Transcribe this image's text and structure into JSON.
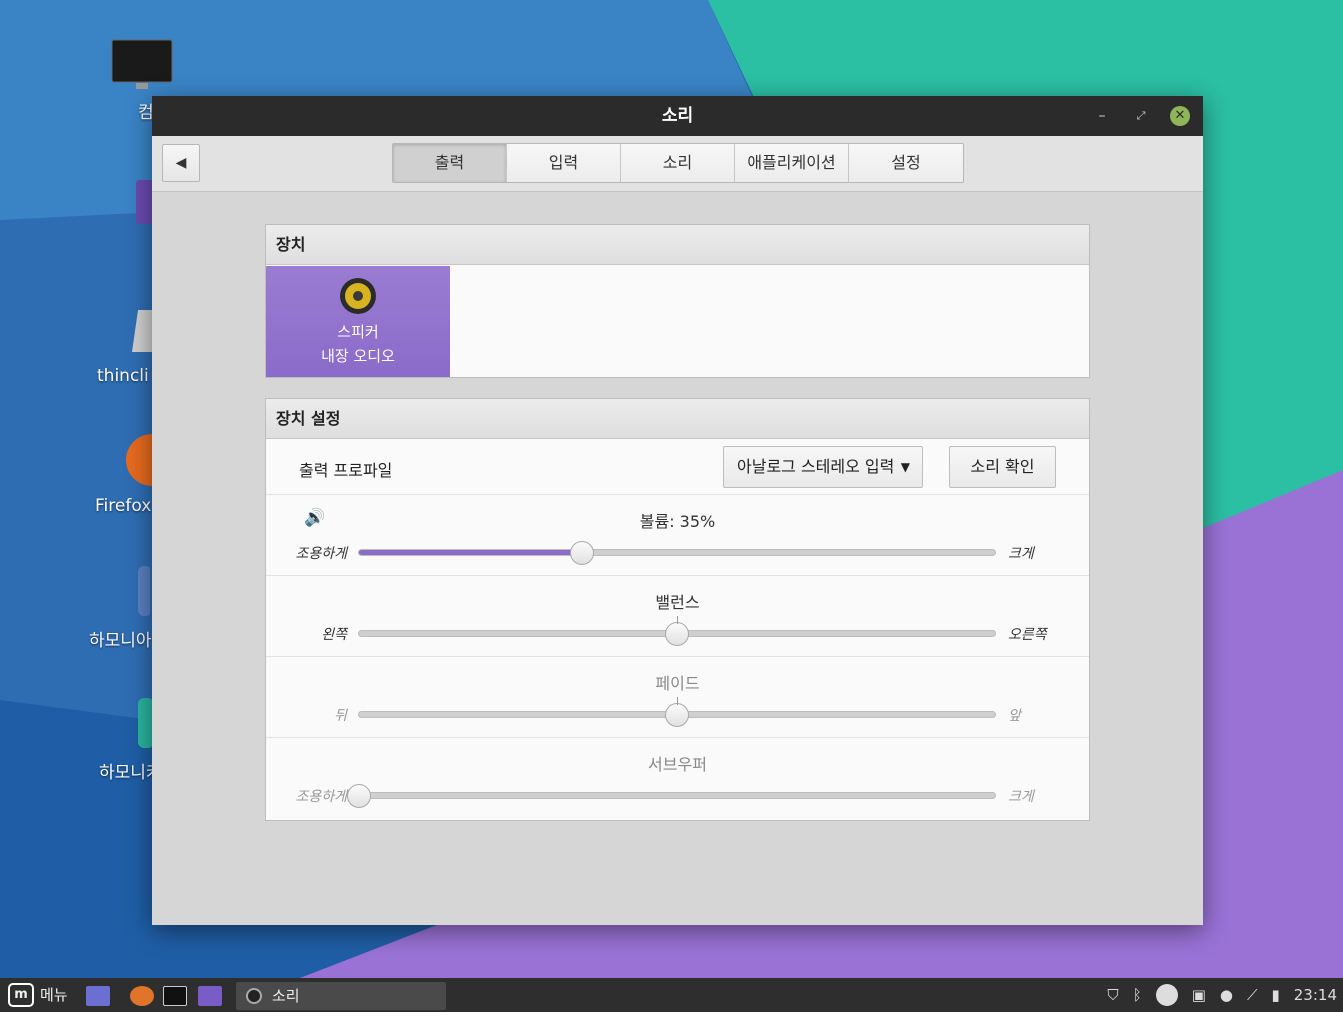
{
  "window": {
    "title": "소리",
    "min_glyph": "–",
    "max_glyph": "⤢",
    "close_glyph": "✕"
  },
  "toolbar": {
    "back_glyph": "◀",
    "tabs": [
      {
        "label": "출력",
        "active": true
      },
      {
        "label": "입력",
        "active": false
      },
      {
        "label": "소리",
        "active": false
      },
      {
        "label": "애플리케이션",
        "active": false
      },
      {
        "label": "설정",
        "active": false
      }
    ]
  },
  "devices": {
    "header": "장치",
    "items": [
      {
        "name": "스피커",
        "description": "내장 오디오",
        "icon": "speaker-icon",
        "selected": true
      }
    ]
  },
  "device_settings": {
    "header": "장치 설정",
    "profile": {
      "label": "출력 프로파일",
      "selected": "아날로그 스테레오 입력",
      "caret": "▼"
    },
    "test_button": "소리 확인",
    "volume": {
      "icon": "volume-icon",
      "icon_glyph": "🔊",
      "label": "볼륨: 35%",
      "left": "조용하게",
      "right": "크게",
      "value_percent": 35
    },
    "balance": {
      "label": "밸런스",
      "left": "왼쪽",
      "right": "오른쪽",
      "value_percent": 50
    },
    "fade": {
      "label": "페이드",
      "left": "뒤",
      "right": "앞",
      "value_percent": 50
    },
    "subwoofer": {
      "label": "서브우퍼",
      "left": "조용하게",
      "right": "크게",
      "value_percent": 0
    }
  },
  "desktop": {
    "icons": [
      {
        "label": "컴",
        "icon": "computer-icon"
      },
      {
        "label": "",
        "icon": "home-folder-icon"
      },
      {
        "label": "thincli",
        "icon": "drive-icon"
      },
      {
        "label": "Firefox",
        "icon": "firefox-icon"
      },
      {
        "label": "하모니아",
        "icon": "harmonia-icon"
      },
      {
        "label": "하모니카",
        "icon": "harmonica-icon"
      }
    ]
  },
  "taskbar": {
    "menu_label": "메뉴",
    "task_label": "소리",
    "clock": "23:14"
  },
  "colors": {
    "accent": "#8c6cc9",
    "titlebar": "#2b2b2b",
    "close": "#8fb55a"
  }
}
